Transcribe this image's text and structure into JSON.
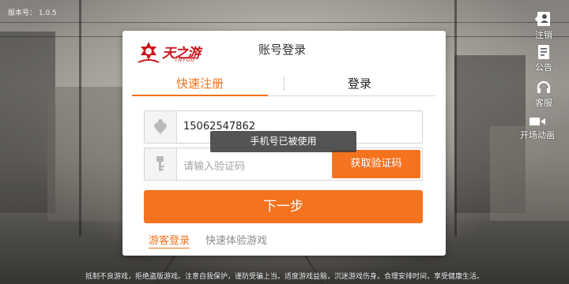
{
  "version_label": "版本号： 1.0.5",
  "side_menu": [
    {
      "icon": "user-logout-icon",
      "label": "注销"
    },
    {
      "icon": "notice-icon",
      "label": "公告"
    },
    {
      "icon": "headset-icon",
      "label": "客服"
    },
    {
      "icon": "video-icon",
      "label": "开场动画"
    }
  ],
  "dialog": {
    "logo_text": "天之游",
    "logo_sub": "TNYOO",
    "title": "账号登录",
    "tabs": [
      {
        "label": "快速注册",
        "active": true
      },
      {
        "label": "登录",
        "active": false
      }
    ],
    "phone_value": "15062547862",
    "code_placeholder": "请输入验证码",
    "get_code_label": "获取验证码",
    "next_label": "下一步",
    "guest_label": "游客登录",
    "guest_desc": "快速体验游戏"
  },
  "toast": "手机号已被使用",
  "bottom_notice": "抵制不良游戏，拒绝盗版游戏。注意自我保护，谨防受骗上当。适度游戏益脑，沉迷游戏伤身。合理安排时间，享受健康生活。",
  "colors": {
    "accent": "#f5731f",
    "brand": "#c8161d"
  }
}
